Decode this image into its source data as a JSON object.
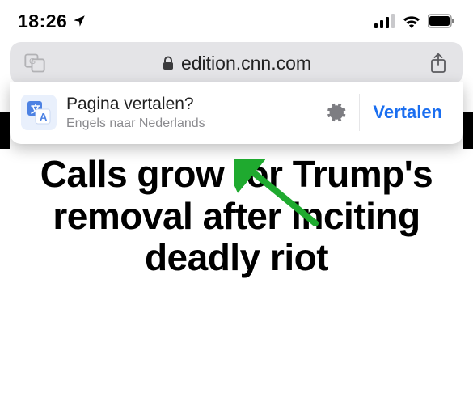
{
  "status": {
    "time": "18:26"
  },
  "address_bar": {
    "domain": "edition.cnn.com"
  },
  "translate_popup": {
    "title": "Pagina vertalen?",
    "subtitle": "Engels naar Nederlands",
    "action": "Vertalen"
  },
  "page": {
    "headline": "Calls grow for Trump's removal after inciting deadly riot"
  }
}
